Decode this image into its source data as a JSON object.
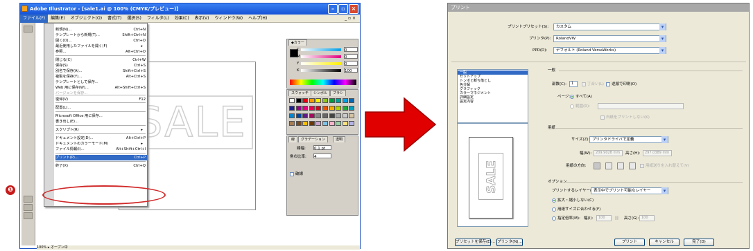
{
  "illustrator": {
    "window_title": "Adobe Illustrator - [sale1.ai @ 100% (CMYK/プレビュー)]",
    "menubar": [
      "ファイル(F)",
      "編集(E)",
      "オブジェクト(O)",
      "書式(T)",
      "選択(S)",
      "フィルタ(L)",
      "効果(C)",
      "表示(V)",
      "ウィンドウ(W)",
      "ヘルプ(H)"
    ],
    "menubar_right": "_ ▫ ×",
    "file_menu": [
      {
        "label": "新規(N)...",
        "shortcut": "Ctrl+N"
      },
      {
        "label": "テンプレートから新規(T)...",
        "shortcut": "Shift+Ctrl+N"
      },
      {
        "label": "開く(O)...",
        "shortcut": "Ctrl+O"
      },
      {
        "label": "最近使用したファイルを開く(F)",
        "shortcut": ""
      },
      {
        "label": "参照...",
        "shortcut": "Alt+Ctrl+O"
      },
      {
        "label": "閉じる(C)",
        "shortcut": "Ctrl+W"
      },
      {
        "label": "保存(S)",
        "shortcut": "Ctrl+S"
      },
      {
        "label": "別名で保存(A)...",
        "shortcut": "Shift+Ctrl+S"
      },
      {
        "label": "複製を保存(Y)...",
        "shortcut": "Alt+Ctrl+S"
      },
      {
        "label": "テンプレートとして保存...",
        "shortcut": ""
      },
      {
        "label": "Web 用に保存(W)...",
        "shortcut": "Alt+Shift+Ctrl+S"
      },
      {
        "label": "バージョンを保存...",
        "shortcut": ""
      },
      {
        "label": "復帰(V)",
        "shortcut": "F12"
      },
      {
        "label": "配置(L)...",
        "shortcut": ""
      },
      {
        "label": "Microsoft Office 用に保存...",
        "shortcut": ""
      },
      {
        "label": "書き出し(E)...",
        "shortcut": ""
      },
      {
        "label": "スクリプト(R)",
        "shortcut": ""
      },
      {
        "label": "ドキュメント設定(D)...",
        "shortcut": "Alt+Ctrl+P"
      },
      {
        "label": "ドキュメントのカラーモード(M)",
        "shortcut": ""
      },
      {
        "label": "ファイル情報(I)...",
        "shortcut": "Alt+Shift+Ctrl+I"
      },
      {
        "label": "プリント(P)...",
        "shortcut": "Ctrl+P"
      },
      {
        "label": "終了(X)",
        "shortcut": "Ctrl+Q"
      }
    ],
    "artwork_text": "SALE",
    "badge": "❶",
    "color_panel": {
      "tab": "◆カラー",
      "channels": [
        "C",
        "M",
        "Y",
        "K"
      ],
      "values": [
        "0",
        "0",
        "0",
        "100"
      ]
    },
    "swatch_tabs": [
      "スウォッチ",
      "シンボル",
      "ブラシ"
    ],
    "stroke_tabs": [
      "線",
      "グラデーション",
      "透明"
    ],
    "stroke": {
      "width_label": "線幅:",
      "width_value": "0.1 pt",
      "miter_label": "角の比率:",
      "miter_value": "4",
      "dash_label": "破線"
    },
    "status": "100%  ▸  オープン中"
  },
  "print_dialog": {
    "title": "プリント",
    "preset_label": "プリントプリセット(S):",
    "preset_value": "カスタム",
    "printer_label": "プリンタ(P):",
    "printer_value": "RolandVW",
    "ppd_label": "PPD(D):",
    "ppd_value": "デフォルト (Roland VersaWorks)",
    "categories": [
      "一般",
      "セットアップ",
      "トンボと断ち落とし",
      "色分解",
      "グラフィック",
      "カラーマネジメント",
      "詳細設定",
      "設定内容"
    ],
    "general_heading": "一般",
    "copies_label": "部数(C):",
    "copies_value": "1",
    "collate_label": "丁合い(L)",
    "reverse_label": "逆順で印刷(O)",
    "pages_label": "ページ:",
    "pages_all": "すべて(A)",
    "range_label": "範囲(R):",
    "skip_blank": "白紙をプリントしない(K)",
    "media_heading": "用紙",
    "size_label": "サイズ(Z):",
    "size_value": "プリンタドライバで定義",
    "width_label": "幅(W):",
    "width_value": "209.9028 mm",
    "height_label": "高さ(H):",
    "height_value": "297.0389 mm",
    "orientation_label": "用紙の方向:",
    "transverse_label": "用紙送りを入れ替えて(V)",
    "options_heading": "オプション",
    "layers_label": "プリントするレイヤー(L):",
    "layers_value": "表示中でプリント可能なレイヤー",
    "scale_none": "拡大・縮小しない(C)",
    "scale_fit": "用紙サイズに合わせる(F)",
    "scale_custom": "指定倍率(M):",
    "scale_w_label": "幅(I):",
    "scale_w_value": "100",
    "scale_h_label": "高さ(G):",
    "scale_h_value": "100",
    "btn_save_preset": "プリセットを保存(E)...",
    "btn_printer": "プリンタ(N)...",
    "btn_print": "プリント",
    "btn_cancel": "キャンセル",
    "btn_done": "完了(D)"
  },
  "colors": {
    "accent_red": "#d12a2a",
    "xp_blue": "#1553d6",
    "highlight": "#316ac5"
  }
}
